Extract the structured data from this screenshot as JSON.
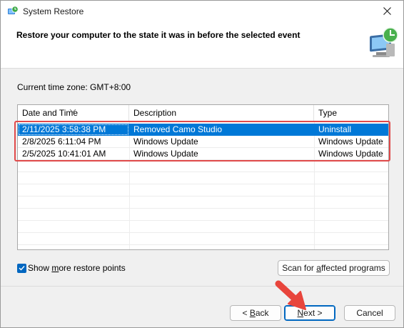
{
  "window": {
    "title": "System Restore",
    "icon": "system-restore-icon",
    "close_icon": "close-icon"
  },
  "header": {
    "heading": "Restore your computer to the state it was in before the selected event",
    "graphic": "system-restore-monitor-icon"
  },
  "timezone": {
    "text": "Current time zone: GMT+8:00"
  },
  "table": {
    "columns": [
      "Date and Time",
      "Description",
      "Type"
    ],
    "sort_column": "Date and Time",
    "rows": [
      {
        "date": "2/11/2025 3:58:38 PM",
        "description": "Removed Camo Studio",
        "type": "Uninstall",
        "selected": true
      },
      {
        "date": "2/8/2025 6:11:04 PM",
        "description": "Windows Update",
        "type": "Windows Update",
        "selected": false
      },
      {
        "date": "2/5/2025 10:41:01 AM",
        "description": "Windows Update",
        "type": "Windows Update",
        "selected": false
      }
    ]
  },
  "options": {
    "show_more_pre": "Show ",
    "show_more_key": "m",
    "show_more_post": "ore restore points",
    "show_more_checked": true,
    "scan_pre": "Scan for ",
    "scan_key": "a",
    "scan_post": "ffected programs"
  },
  "buttons": {
    "back_pre": "< ",
    "back_key": "B",
    "back_post": "ack",
    "next_key": "N",
    "next_post": "ext >",
    "cancel": "Cancel"
  },
  "colors": {
    "selection": "#0078d7",
    "annotation": "#e04a4a",
    "accent": "#0067c0"
  }
}
